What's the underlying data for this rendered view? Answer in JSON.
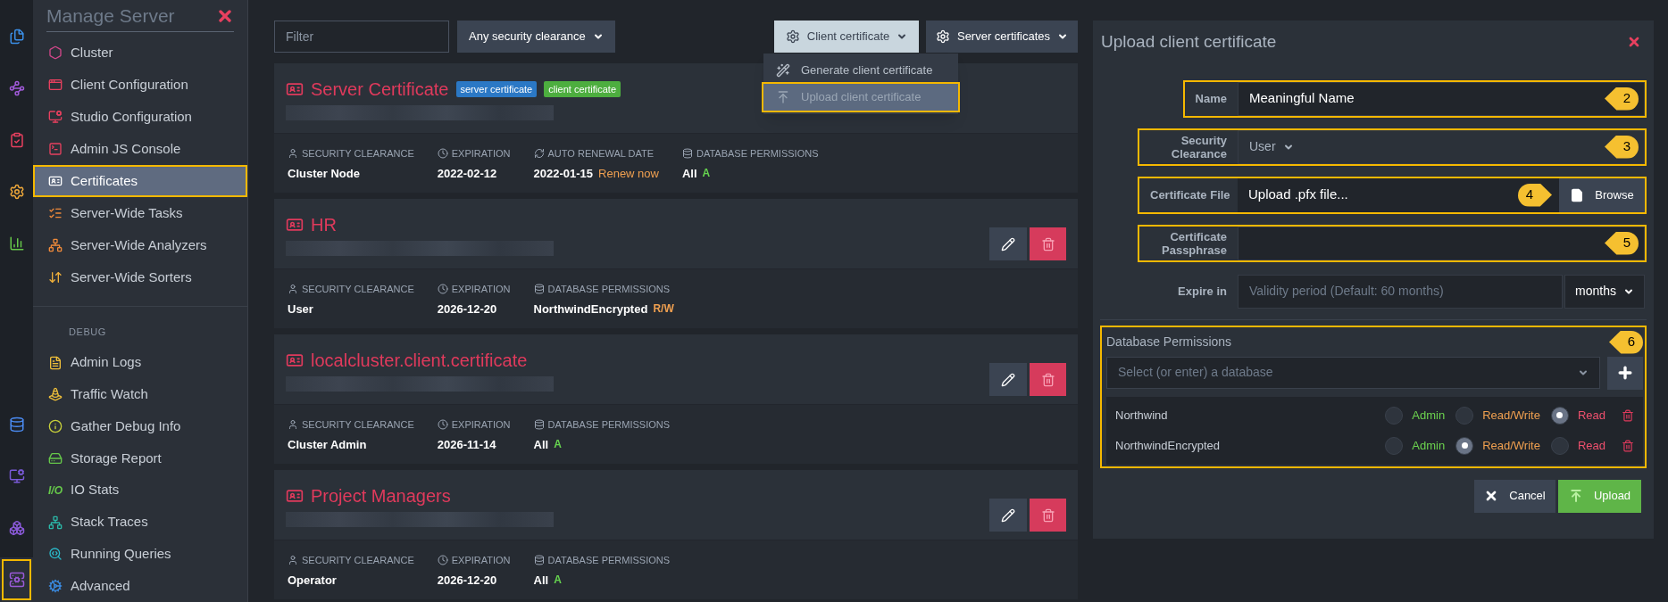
{
  "rail": [
    {
      "selected": false,
      "highlighted": false
    },
    {
      "selected": false,
      "highlighted": false
    },
    {
      "selected": false,
      "highlighted": false
    },
    {
      "selected": false,
      "highlighted": false
    },
    {
      "selected": false,
      "highlighted": false
    },
    {
      "selected": false,
      "highlighted": false
    },
    {
      "selected": false,
      "highlighted": false
    },
    {
      "selected": false,
      "highlighted": false
    },
    {
      "selected": true,
      "highlighted": true
    }
  ],
  "sidebar": {
    "title": "Manage Server",
    "items": [
      {
        "label": "Cluster",
        "selected": false,
        "highlighted": false
      },
      {
        "label": "Client Configuration",
        "selected": false,
        "highlighted": false
      },
      {
        "label": "Studio Configuration",
        "selected": false,
        "highlighted": false
      },
      {
        "label": "Admin JS Console",
        "selected": false,
        "highlighted": false
      },
      {
        "label": "Certificates",
        "selected": true,
        "highlighted": true
      },
      {
        "label": "Server-Wide Tasks",
        "selected": false,
        "highlighted": false
      },
      {
        "label": "Server-Wide Analyzers",
        "selected": false,
        "highlighted": false
      },
      {
        "label": "Server-Wide Sorters",
        "selected": false,
        "highlighted": false
      }
    ],
    "section": "DEBUG",
    "debug_items": [
      {
        "label": "Admin Logs",
        "selected": false
      },
      {
        "label": "Traffic Watch",
        "selected": false
      },
      {
        "label": "Gather Debug Info",
        "selected": false
      },
      {
        "label": "Storage Report",
        "selected": false
      },
      {
        "label": "IO Stats",
        "selected": false,
        "glyph": "I/O"
      },
      {
        "label": "Stack Traces",
        "selected": false
      },
      {
        "label": "Running Queries",
        "selected": false
      },
      {
        "label": "Advanced",
        "selected": false
      }
    ]
  },
  "toolbar": {
    "filter": {
      "placeholder": "Filter"
    },
    "clearance_dropdown": "Any security clearance",
    "client_button": "Client certificate",
    "server_button": "Server certificates",
    "menu": [
      {
        "label": "Generate client certificate",
        "selected": false,
        "highlighted": false
      },
      {
        "label": "Upload client certificate",
        "selected": true,
        "highlighted": true
      }
    ]
  },
  "certificates": [
    {
      "name": "Server Certificate",
      "actions": false,
      "tags": [
        {
          "label": "server certificate",
          "color": "#2b78c5"
        },
        {
          "label": "client certificate",
          "color": "#4dae3f"
        }
      ],
      "fields": [
        {
          "kind": "clearance",
          "label": "SECURITY CLEARANCE",
          "value": "Cluster Node"
        },
        {
          "kind": "expiration",
          "label": "EXPIRATION",
          "value": "2022-02-12"
        },
        {
          "kind": "renewal",
          "label": "AUTO RENEWAL DATE",
          "value": "2022-01-15",
          "link": "Renew now"
        },
        {
          "kind": "permissions",
          "label": "DATABASE PERMISSIONS",
          "value": "All",
          "badge": {
            "label": "A",
            "kind": "admin"
          }
        }
      ]
    },
    {
      "name": "HR",
      "actions": true,
      "fields": [
        {
          "kind": "clearance",
          "label": "SECURITY CLEARANCE",
          "value": "User"
        },
        {
          "kind": "expiration",
          "label": "EXPIRATION",
          "value": "2026-12-20"
        },
        {
          "kind": "permissions",
          "label": "DATABASE PERMISSIONS",
          "value": "NorthwindEncrypted",
          "badge": {
            "label": "R/W",
            "kind": "readwrite"
          }
        }
      ]
    },
    {
      "name": "localcluster.client.certificate",
      "actions": true,
      "fields": [
        {
          "kind": "clearance",
          "label": "SECURITY CLEARANCE",
          "value": "Cluster Admin"
        },
        {
          "kind": "expiration",
          "label": "EXPIRATION",
          "value": "2026-11-14"
        },
        {
          "kind": "permissions",
          "label": "DATABASE PERMISSIONS",
          "value": "All",
          "badge": {
            "label": "A",
            "kind": "admin"
          }
        }
      ]
    },
    {
      "name": "Project Managers",
      "actions": true,
      "fields": [
        {
          "kind": "clearance",
          "label": "SECURITY CLEARANCE",
          "value": "Operator"
        },
        {
          "kind": "expiration",
          "label": "EXPIRATION",
          "value": "2026-12-20"
        },
        {
          "kind": "permissions",
          "label": "DATABASE PERMISSIONS",
          "value": "All",
          "badge": {
            "label": "A",
            "kind": "admin"
          }
        }
      ]
    }
  ],
  "panel": {
    "title": "Upload client certificate",
    "name": {
      "label": "Name",
      "value": "Meaningful Name",
      "callout": {
        "number": "2",
        "kind": "left"
      }
    },
    "clearance": {
      "label": "Security Clearance",
      "value": "User",
      "callout": {
        "number": "3",
        "kind": "left"
      }
    },
    "file": {
      "label": "Certificate File",
      "value": "Upload .pfx file...",
      "browse": "Browse",
      "callout": {
        "number": "4",
        "kind": "right"
      }
    },
    "passphrase": {
      "label": "Certificate Passphrase",
      "callout": {
        "number": "5",
        "kind": "left"
      }
    },
    "expire": {
      "label": "Expire in",
      "placeholder": "Validity period (Default: 60 months)",
      "unit": "months"
    },
    "permissions": {
      "title": "Database Permissions",
      "callout": {
        "number": "6",
        "kind": "left"
      },
      "placeholder": "Select (or enter) a database",
      "rows": [
        {
          "name": "Northwind",
          "options": [
            {
              "label": "Admin",
              "kind": "admin",
              "selected": false
            },
            {
              "label": "Read/Write",
              "kind": "readwrite",
              "selected": false
            },
            {
              "label": "Read",
              "kind": "read",
              "selected": true
            }
          ]
        },
        {
          "name": "NorthwindEncrypted",
          "options": [
            {
              "label": "Admin",
              "kind": "admin",
              "selected": false
            },
            {
              "label": "Read/Write",
              "kind": "readwrite",
              "selected": true
            },
            {
              "label": "Read",
              "kind": "read",
              "selected": false
            }
          ]
        }
      ]
    },
    "cancel": "Cancel",
    "upload": "Upload"
  }
}
